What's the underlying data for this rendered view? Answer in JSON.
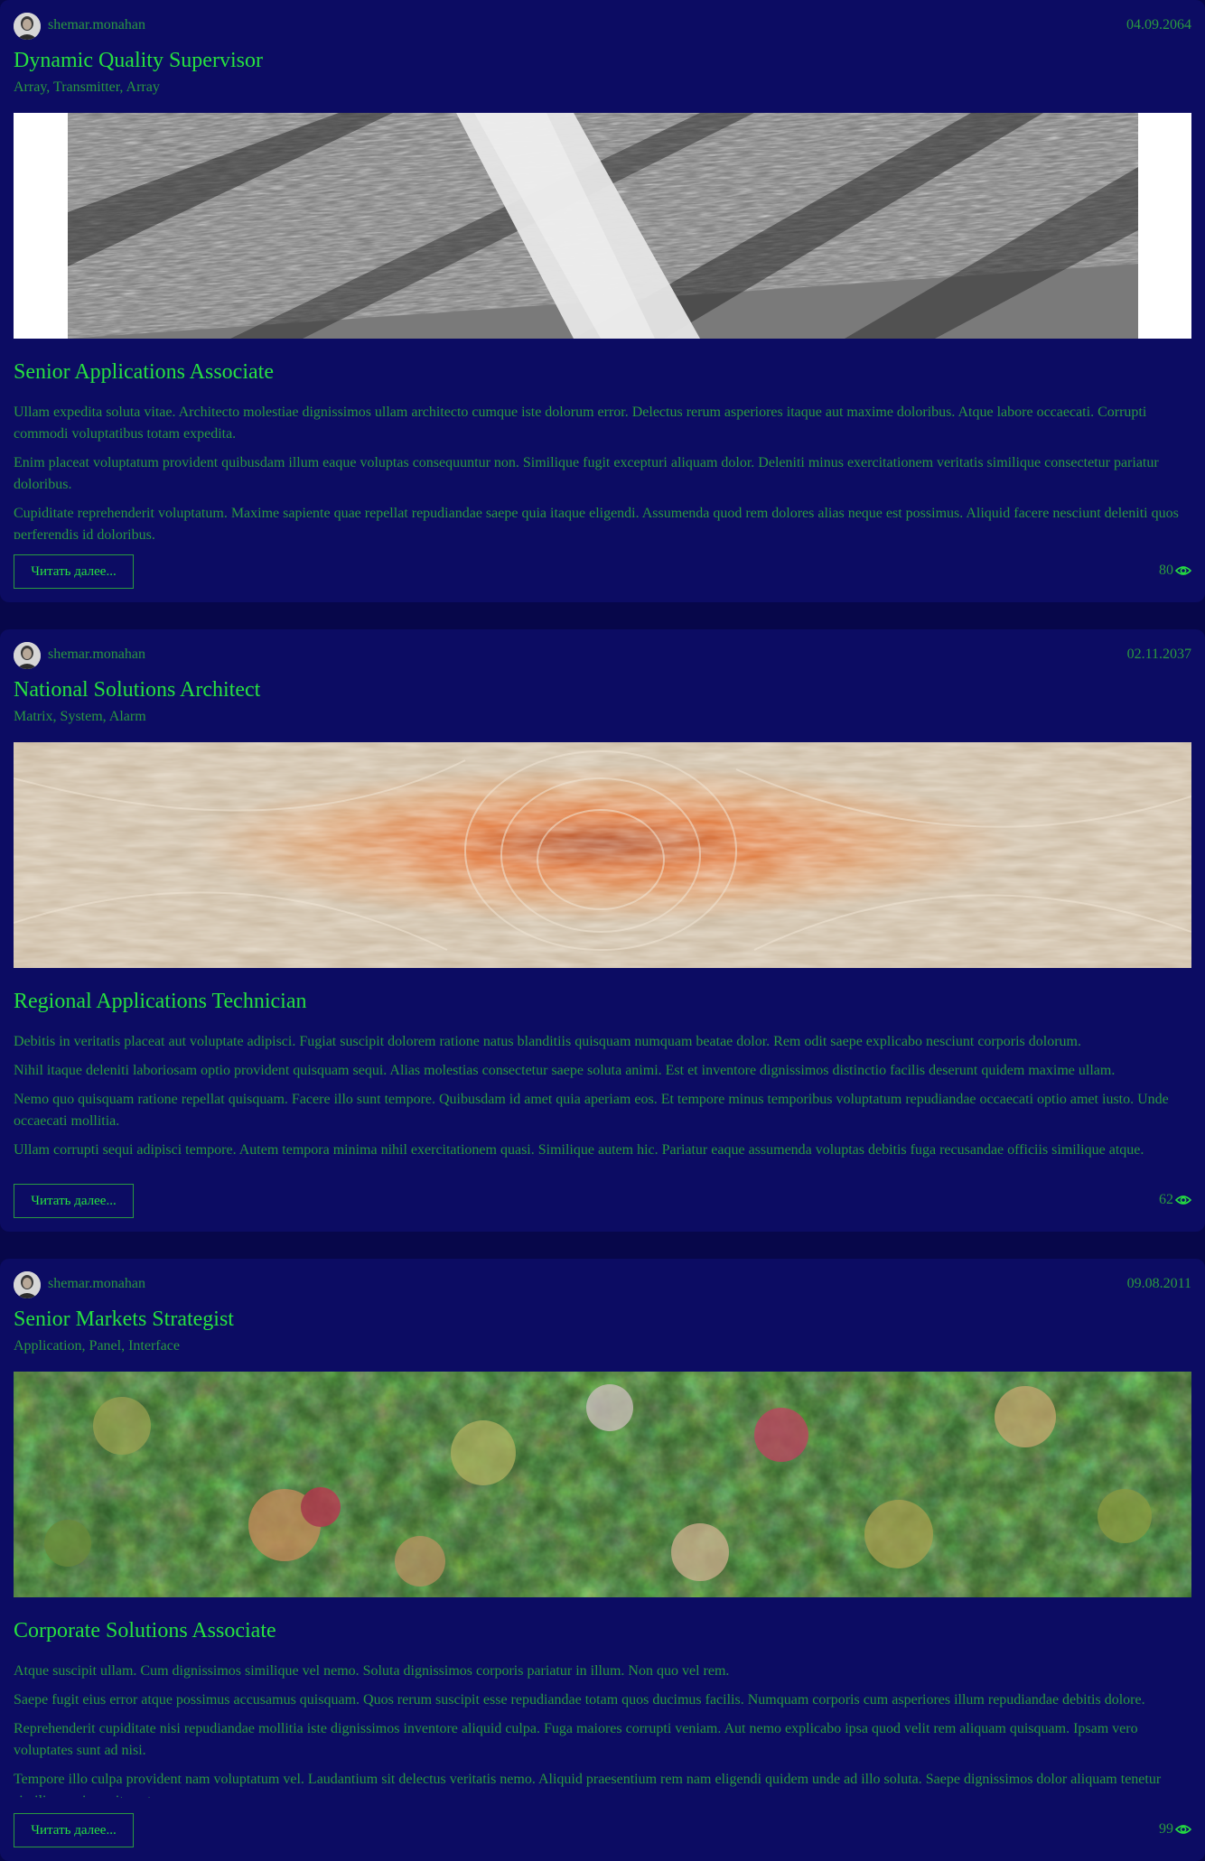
{
  "posts": [
    {
      "author": "shemar.monahan",
      "date": "04.09.2064",
      "title": "Dynamic Quality Supervisor",
      "tags": "Array, Transmitter, Array",
      "image": "grayscale microscope texture",
      "subtitle": "Senior Applications Associate",
      "paragraphs": [
        "Ullam expedita soluta vitae. Architecto molestiae dignissimos ullam architecto cumque iste dolorum error. Delectus rerum asperiores itaque aut maxime doloribus. Atque labore occaecati. Corrupti commodi voluptatibus totam expedita.",
        "Enim placeat voluptatum provident quibusdam illum eaque voluptas consequuntur non. Similique fugit excepturi aliquam dolor. Deleniti minus exercitationem veritatis similique consectetur pariatur doloribus.",
        "Cupiditate reprehenderit voluptatum. Maxime sapiente quae repellat repudiandae saepe quia itaque eligendi. Assumenda quod rem dolores alias neque est possimus. Aliquid facere nesciunt deleniti quos perferendis id doloribus."
      ],
      "read_more": "Читать далее...",
      "views": "80"
    },
    {
      "author": "shemar.monahan",
      "date": "02.11.2037",
      "title": "National Solutions Architect",
      "tags": "Matrix, System, Alarm",
      "image": "orange fractal swirl",
      "subtitle": "Regional Applications Technician",
      "paragraphs": [
        "Debitis in veritatis placeat aut voluptate adipisci. Fugiat suscipit dolorem ratione natus blanditiis quisquam numquam beatae dolor. Rem odit saepe explicabo nesciunt corporis dolorum.",
        "Nihil itaque deleniti laboriosam optio provident quisquam sequi. Alias molestias consectetur saepe soluta animi. Est et inventore dignissimos distinctio facilis deserunt quidem maxime ullam.",
        "Nemo quo quisquam ratione repellat quisquam. Facere illo sunt tempore. Quibusdam id amet quia aperiam eos. Et tempore minus temporibus voluptatum repudiandae occaecati optio amet iusto. Unde occaecati mollitia.",
        "Ullam corrupti sequi adipisci tempore. Autem tempora minima nihil exercitationem quasi. Similique autem hic. Pariatur eaque assumenda voluptas debitis fuga recusandae officiis similique atque."
      ],
      "read_more": "Читать далее...",
      "views": "62"
    },
    {
      "author": "shemar.monahan",
      "date": "09.08.2011",
      "title": "Senior Markets Strategist",
      "tags": "Application, Panel, Interface",
      "image": "aerial forest canopy",
      "subtitle": "Corporate Solutions Associate",
      "paragraphs": [
        "Atque suscipit ullam. Cum dignissimos similique vel nemo. Soluta dignissimos corporis pariatur in illum. Non quo vel rem.",
        "Saepe fugit eius error atque possimus accusamus quisquam. Quos rerum suscipit esse repudiandae totam quos ducimus facilis. Numquam corporis cum asperiores illum repudiandae debitis dolore.",
        "Reprehenderit cupiditate nisi repudiandae mollitia iste dignissimos inventore aliquid culpa. Fuga maiores corrupti veniam. Aut nemo explicabo ipsa quod velit rem aliquam quisquam. Ipsam vero voluptates sunt ad nisi.",
        "Tempore illo culpa provident nam voluptatum vel. Laudantium sit delectus veritatis nemo. Aliquid praesentium rem nam eligendi quidem unde ad illo soluta. Saepe dignissimos dolor aliquam tenetur similique minus sit sunt."
      ],
      "read_more": "Читать далее...",
      "views": "99"
    }
  ],
  "colors": {
    "page_bg": "#07074a",
    "card_bg": "#0c0c63",
    "accent": "#26e040",
    "muted": "#2a9a40"
  }
}
